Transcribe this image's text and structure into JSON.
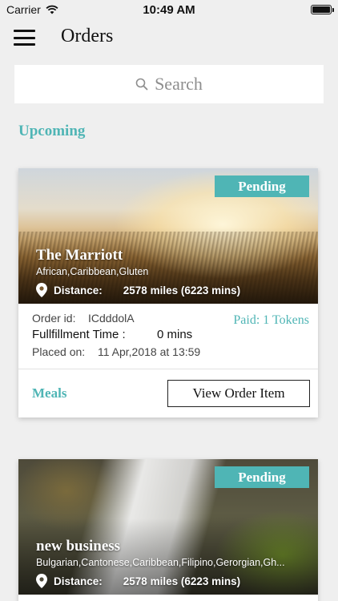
{
  "status_bar": {
    "carrier": "Carrier",
    "time": "10:49 AM"
  },
  "nav": {
    "title": "Orders",
    "menu_icon": "hamburger-menu-icon"
  },
  "search": {
    "placeholder": "Search",
    "icon": "search-icon"
  },
  "section": {
    "title": "Upcoming"
  },
  "colors": {
    "accent": "#4fb5b5",
    "background": "#efefef"
  },
  "orders": [
    {
      "status": "Pending",
      "business_name": "The Marriott",
      "cuisines": "African,Caribbean,Gluten",
      "distance_label": "Distance:",
      "distance_value": "2578 miles (6223 mins)",
      "order_id_label": "Order id:",
      "order_id": "ICdddolA",
      "fulfillment_label": "Fullfillment Time :",
      "fulfillment_value": "0 mins",
      "placed_label": "Placed on:",
      "placed_value": "11 Apr,2018 at 13:59",
      "paid": "Paid: 1 Tokens",
      "category": "Meals",
      "action_label": "View Order Item"
    },
    {
      "status": "Pending",
      "business_name": "new business",
      "cuisines": "Bulgarian,Cantonese,Caribbean,Filipino,Gerorgian,Gh...",
      "distance_label": "Distance:",
      "distance_value": "2578 miles (6223 mins)"
    }
  ]
}
